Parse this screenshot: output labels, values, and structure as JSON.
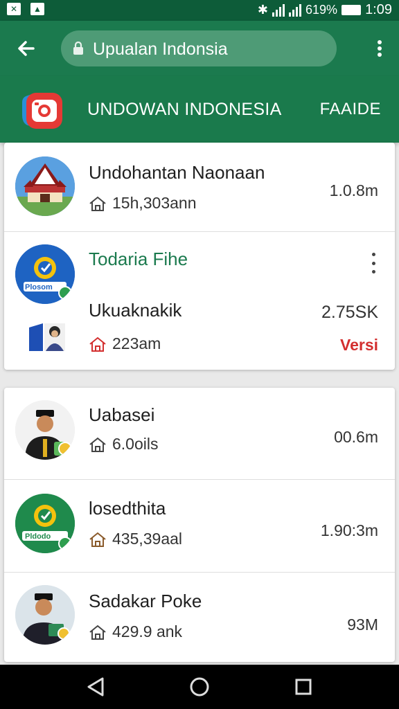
{
  "status_bar": {
    "battery": "619%",
    "time": "1:09"
  },
  "app_bar": {
    "search_text": "Upualan Indonsia"
  },
  "banner": {
    "title": "UNDOWAN INDONESIA",
    "action": "FAAIDE"
  },
  "card1": {
    "item1": {
      "title": "Undohantan Naonaan",
      "meta": "15h,303ann",
      "value": "1.0.8m"
    },
    "item2": {
      "header": "Todaria Fihe",
      "avatar_label": "Plosom",
      "title": "Ukuaknakik",
      "meta": "223am",
      "value": "2.75SK",
      "status": "Versi"
    }
  },
  "card2": {
    "items": [
      {
        "title": "Uabasei",
        "meta": "6.0oils",
        "value": "00.6m"
      },
      {
        "title": "losedthita",
        "meta": "435,39aal",
        "value": "1.90:3m",
        "avatar_label": "Pldodo"
      },
      {
        "title": "Sadakar Poke",
        "meta": "429.9 ank",
        "value": "93M"
      }
    ]
  },
  "colors": {
    "status_bar": "#0d5c39",
    "app_bar": "#1b7a4e",
    "accent_red": "#d32f2f",
    "accent_green": "#1b7a4e"
  },
  "icons": [
    "back-arrow-icon",
    "lock-icon",
    "overflow-menu-icon",
    "camera-logo-icon",
    "home-icon",
    "nav-back-icon",
    "nav-home-icon",
    "nav-recents-icon"
  ]
}
